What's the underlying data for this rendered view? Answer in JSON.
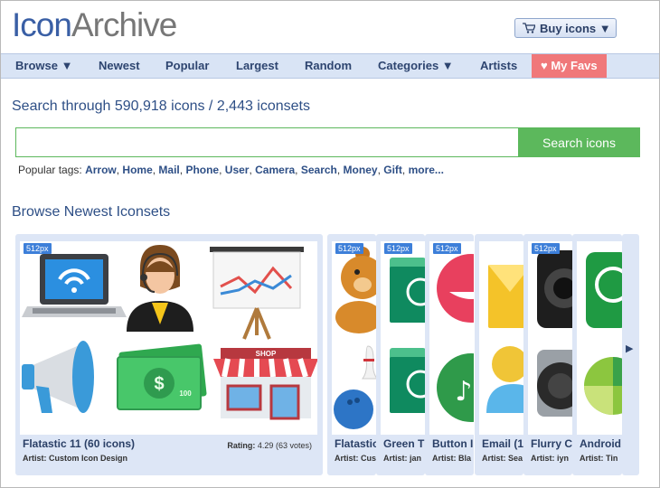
{
  "logo": {
    "part1": "Icon",
    "part2": "Archive"
  },
  "header": {
    "buy_label": "Buy icons ▼"
  },
  "nav": {
    "browse": "Browse ▼",
    "newest": "Newest",
    "popular": "Popular",
    "largest": "Largest",
    "random": "Random",
    "categories": "Categories ▼",
    "artists": "Artists",
    "favs": "♥ My Favs"
  },
  "search": {
    "title": "Search through 590,918 icons / 2,443 iconsets",
    "placeholder": "",
    "button": "Search icons"
  },
  "tags": {
    "label": "Popular tags:",
    "items": [
      "Arrow",
      "Home",
      "Mail",
      "Phone",
      "User",
      "Camera",
      "Search",
      "Money",
      "Gift",
      "more..."
    ]
  },
  "browse": {
    "title": "Browse Newest Iconsets",
    "cards": [
      {
        "badge": "512px",
        "title": "Flatastic 11 (60 icons)",
        "artist": "Artist: Custom Icon Design",
        "rating_label": "Rating:",
        "rating_value": "4.29",
        "votes": "(63 votes)"
      },
      {
        "badge": "512px",
        "title": "Flatastic",
        "artist": "Artist: Cus"
      },
      {
        "badge": "512px",
        "title": "Green T",
        "artist": "Artist: jan"
      },
      {
        "badge": "512px",
        "title": "Button I",
        "artist": "Artist: Bla"
      },
      {
        "badge": "",
        "title": "Email (1",
        "artist": "Artist: Sea"
      },
      {
        "badge": "512px",
        "title": "Flurry C",
        "artist": "Artist: iyn"
      },
      {
        "badge": "",
        "title": "Android",
        "artist": "Artist: Tin"
      }
    ],
    "next_arrow": "▶"
  },
  "colors": {
    "brand_blue": "#3a5fa5",
    "nav_bg": "#d9e4f5",
    "fav_bg": "#f0787a",
    "search_green": "#5cb85c",
    "card_bg": "#dde6f6",
    "badge_blue": "#3d7fd9"
  }
}
